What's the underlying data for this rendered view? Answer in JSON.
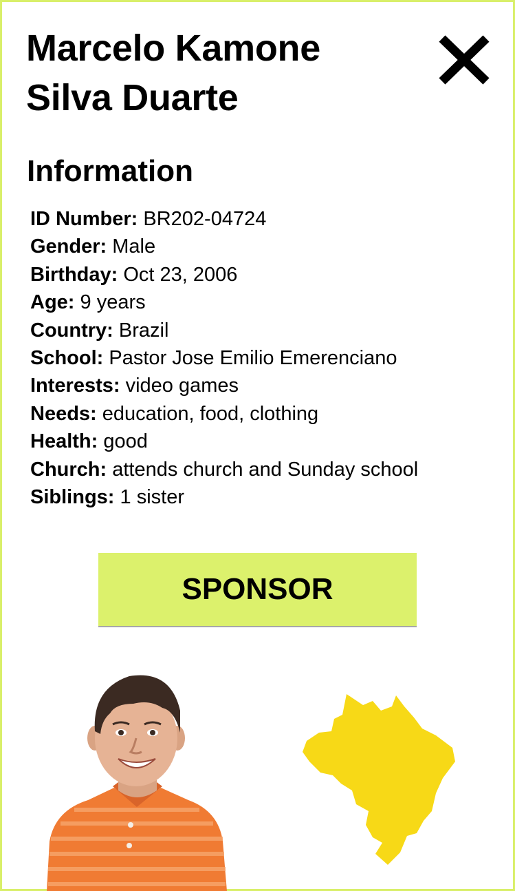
{
  "profile": {
    "name_line1": "Marcelo Kamone",
    "name_line2": "Silva Duarte",
    "section_title": "Information",
    "fields": [
      {
        "label": "ID Number:",
        "value": "BR202-04724"
      },
      {
        "label": "Gender:",
        "value": "Male"
      },
      {
        "label": "Birthday:",
        "value": "Oct 23, 2006"
      },
      {
        "label": "Age:",
        "value": "9 years"
      },
      {
        "label": "Country:",
        "value": "Brazil"
      },
      {
        "label": "School:",
        "value": "Pastor Jose Emilio Emerenciano"
      },
      {
        "label": "Interests:",
        "value": "video games"
      },
      {
        "label": "Needs:",
        "value": "education, food, clothing"
      },
      {
        "label": "Health:",
        "value": "good"
      },
      {
        "label": "Church:",
        "value": "attends church and Sunday school"
      },
      {
        "label": "Siblings:",
        "value": "1 sister"
      }
    ]
  },
  "actions": {
    "sponsor_label": "SPONSOR",
    "close_icon": "close-icon"
  },
  "colors": {
    "accent": "#dcf16c",
    "frame": "#d9ef6a",
    "map_fill": "#f7d917"
  },
  "images": {
    "photo": "child-photo",
    "map": "brazil-map"
  }
}
